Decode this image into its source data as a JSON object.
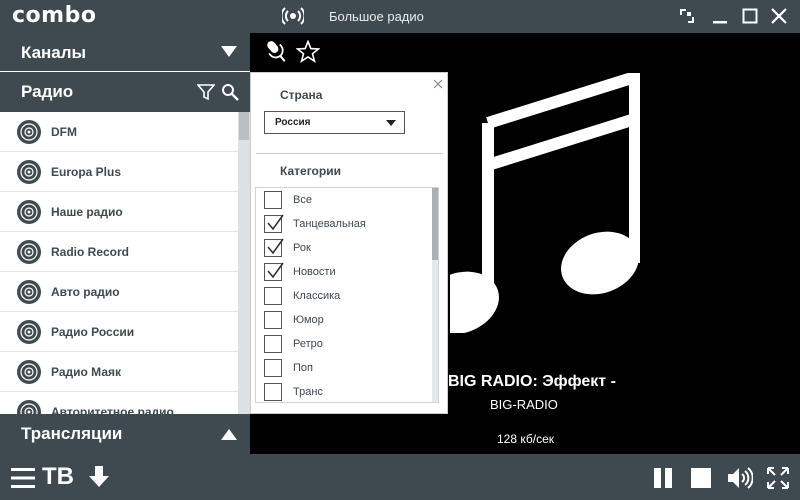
{
  "app": {
    "logo": "combo",
    "station_title": "Большое радио"
  },
  "sections": {
    "channels": "Каналы",
    "radio": "Радио",
    "broadcasts": "Трансляции"
  },
  "radio_list": [
    "DFM",
    "Europa Plus",
    "Наше радио",
    "Radio Record",
    "Авто радио",
    "Радио России",
    "Радио Маяк",
    "Авторитетное радио"
  ],
  "filter": {
    "country_label": "Страна",
    "country_value": "Россия",
    "categories_label": "Категории",
    "categories": [
      {
        "label": "Все",
        "checked": false
      },
      {
        "label": "Танцевальная",
        "checked": true
      },
      {
        "label": "Рок",
        "checked": true
      },
      {
        "label": "Новости",
        "checked": true
      },
      {
        "label": "Классика",
        "checked": false
      },
      {
        "label": "Юмор",
        "checked": false
      },
      {
        "label": "Ретро",
        "checked": false
      },
      {
        "label": "Поп",
        "checked": false
      },
      {
        "label": "Транс",
        "checked": false
      }
    ]
  },
  "now_playing": {
    "title": "BIG RADIO: Эффект -",
    "artist": "BIG-RADIO",
    "bitrate": "128 кб/сек"
  },
  "bottom": {
    "tv_label": "ТВ"
  },
  "colors": {
    "chrome": "#3f4a50",
    "stage": "#000000",
    "panel": "#ffffff"
  }
}
